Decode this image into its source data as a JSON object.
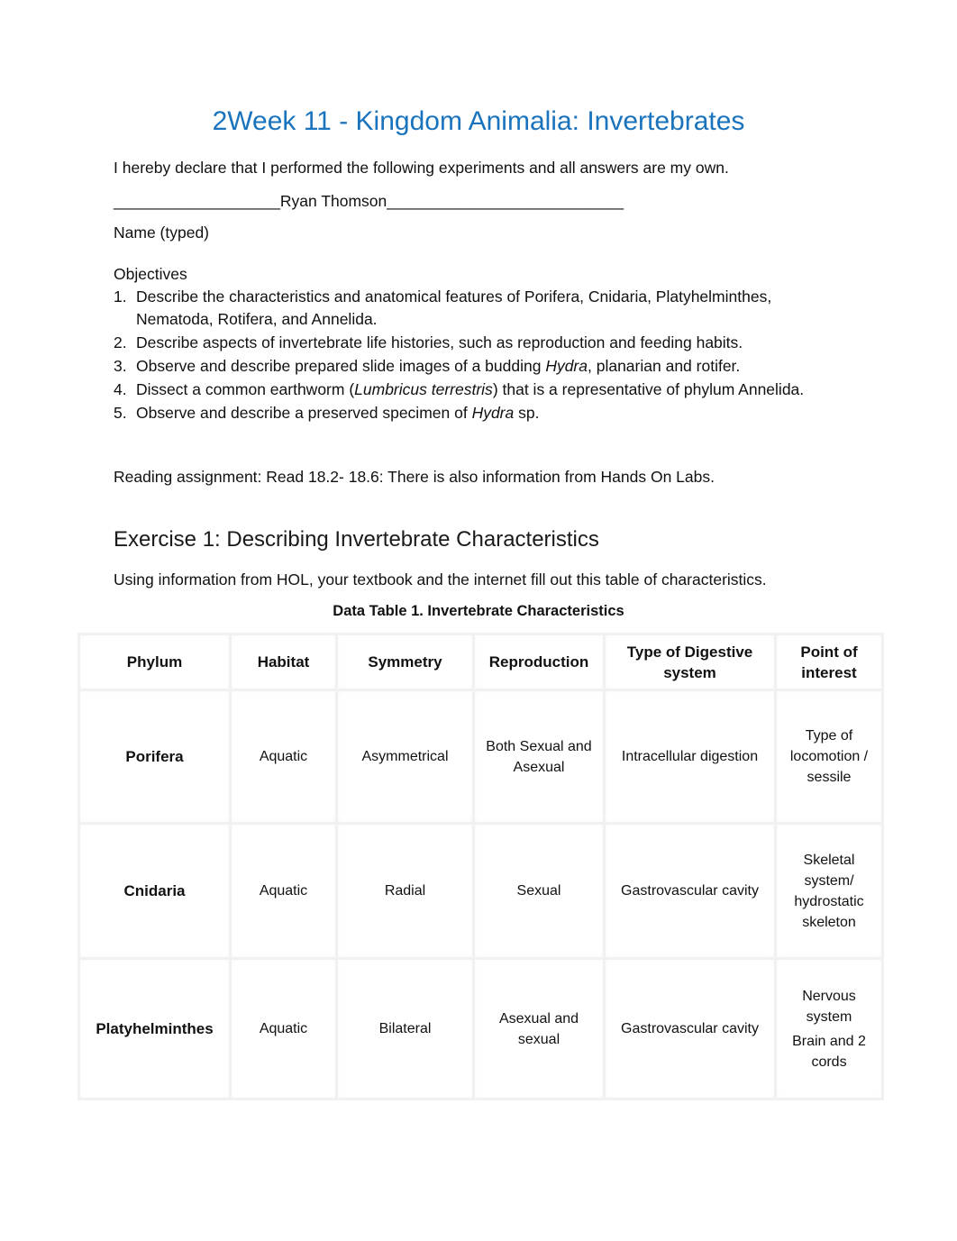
{
  "document": {
    "title": "2Week 11 - Kingdom Animalia: Invertebrates",
    "declaration": "I hereby declare that I performed the following experiments and all answers are my own.",
    "signature_line": "___________________Ryan Thomson___________________________",
    "name_label": "Name (typed)",
    "objectives_heading": "Objectives",
    "objectives": [
      {
        "num": "1.",
        "parts": [
          {
            "text": "Describe the characteristics and anatomical features of Porifera, Cnidaria, Platyhelminthes, Nematoda, Rotifera, and Annelida.",
            "italic": false
          }
        ]
      },
      {
        "num": "2.",
        "parts": [
          {
            "text": "Describe aspects of invertebrate life histories, such as reproduction and feeding habits.",
            "italic": false
          }
        ]
      },
      {
        "num": "3.",
        "parts": [
          {
            "text": "Observe and describe prepared slide images of a budding ",
            "italic": false
          },
          {
            "text": "Hydra",
            "italic": true
          },
          {
            "text": ", planarian and rotifer.",
            "italic": false
          }
        ]
      },
      {
        "num": "4.",
        "parts": [
          {
            "text": "Dissect a common earthworm (",
            "italic": false
          },
          {
            "text": "Lumbricus terrestris",
            "italic": true
          },
          {
            "text": ") that is a representative of phylum Annelida.",
            "italic": false
          }
        ]
      },
      {
        "num": "5.",
        "parts": [
          {
            "text": "Observe and describe a preserved specimen of ",
            "italic": false
          },
          {
            "text": "Hydra",
            "italic": true
          },
          {
            "text": " sp.",
            "italic": false
          }
        ]
      }
    ],
    "reading_assignment": "Reading assignment:  Read 18.2- 18.6: There is also information from Hands On Labs.",
    "exercise_heading": "Exercise 1: Describing Invertebrate Characteristics",
    "exercise_instructions": "Using information from HOL, your textbook and the internet fill out this table of characteristics.",
    "table_caption": "Data Table 1. Invertebrate Characteristics",
    "colors": {
      "title": "#1a73bd",
      "text": "#111111",
      "table_border": "#f1f1f1"
    }
  },
  "table": {
    "headers": [
      "Phylum",
      "Habitat",
      "Symmetry",
      "Reproduction",
      "Type of Digestive system",
      "Point of interest"
    ],
    "rows": [
      {
        "phylum": "Porifera",
        "habitat": "Aquatic",
        "symmetry": "Asymmetrical",
        "reproduction": "Both Sexual and Asexual",
        "digestive": "Intracellular digestion",
        "poi": [
          "Type of locomotion / sessile"
        ]
      },
      {
        "phylum": "Cnidaria",
        "habitat": "Aquatic",
        "symmetry": "Radial",
        "reproduction": "Sexual",
        "digestive": "Gastrovascular cavity",
        "poi": [
          "Skeletal system/ hydrostatic skeleton"
        ]
      },
      {
        "phylum": "Platyhelminthes",
        "habitat": "Aquatic",
        "symmetry": "Bilateral",
        "reproduction": "Asexual and sexual",
        "digestive": "Gastrovascular cavity",
        "poi": [
          "Nervous system",
          "Brain and 2 cords"
        ]
      }
    ]
  }
}
